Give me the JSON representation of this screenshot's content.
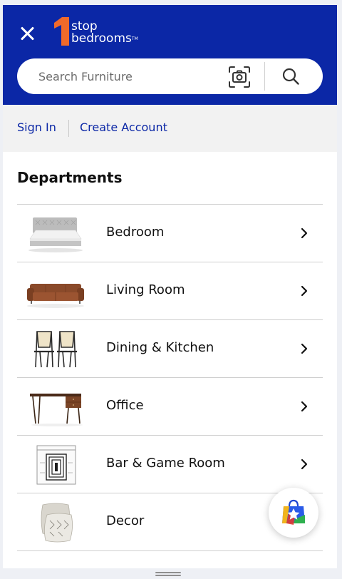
{
  "header": {
    "close_icon": "close-icon",
    "logo": {
      "one": "1",
      "line1": "stop",
      "line2": "bedrooms",
      "tm": "TM"
    },
    "brand_color": "#0b27a6",
    "logo_accent": "#f06a2a"
  },
  "search": {
    "placeholder": "Search Furniture",
    "camera_icon": "camera-search-icon",
    "search_icon": "search-icon"
  },
  "account": {
    "sign_in": "Sign In",
    "create_account": "Create Account"
  },
  "departments": {
    "title": "Departments",
    "items": [
      {
        "label": "Bedroom",
        "image": "bed-image"
      },
      {
        "label": "Living Room",
        "image": "sofa-image"
      },
      {
        "label": "Dining & Kitchen",
        "image": "dining-chairs-image"
      },
      {
        "label": "Office",
        "image": "desk-image"
      },
      {
        "label": "Bar & Game Room",
        "image": "bar-cabinet-image"
      },
      {
        "label": "Decor",
        "image": "pillows-image"
      }
    ]
  },
  "fab": {
    "icon": "shopping-bag-star-icon"
  }
}
